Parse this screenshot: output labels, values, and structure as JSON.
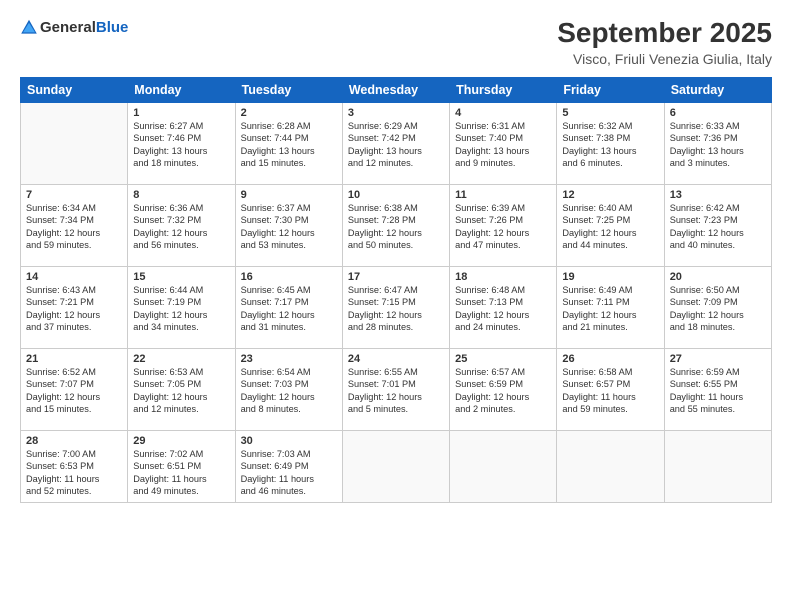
{
  "header": {
    "logo_general": "General",
    "logo_blue": "Blue",
    "month": "September 2025",
    "location": "Visco, Friuli Venezia Giulia, Italy"
  },
  "days_of_week": [
    "Sunday",
    "Monday",
    "Tuesday",
    "Wednesday",
    "Thursday",
    "Friday",
    "Saturday"
  ],
  "weeks": [
    [
      {
        "day": "",
        "lines": []
      },
      {
        "day": "1",
        "lines": [
          "Sunrise: 6:27 AM",
          "Sunset: 7:46 PM",
          "Daylight: 13 hours",
          "and 18 minutes."
        ]
      },
      {
        "day": "2",
        "lines": [
          "Sunrise: 6:28 AM",
          "Sunset: 7:44 PM",
          "Daylight: 13 hours",
          "and 15 minutes."
        ]
      },
      {
        "day": "3",
        "lines": [
          "Sunrise: 6:29 AM",
          "Sunset: 7:42 PM",
          "Daylight: 13 hours",
          "and 12 minutes."
        ]
      },
      {
        "day": "4",
        "lines": [
          "Sunrise: 6:31 AM",
          "Sunset: 7:40 PM",
          "Daylight: 13 hours",
          "and 9 minutes."
        ]
      },
      {
        "day": "5",
        "lines": [
          "Sunrise: 6:32 AM",
          "Sunset: 7:38 PM",
          "Daylight: 13 hours",
          "and 6 minutes."
        ]
      },
      {
        "day": "6",
        "lines": [
          "Sunrise: 6:33 AM",
          "Sunset: 7:36 PM",
          "Daylight: 13 hours",
          "and 3 minutes."
        ]
      }
    ],
    [
      {
        "day": "7",
        "lines": [
          "Sunrise: 6:34 AM",
          "Sunset: 7:34 PM",
          "Daylight: 12 hours",
          "and 59 minutes."
        ]
      },
      {
        "day": "8",
        "lines": [
          "Sunrise: 6:36 AM",
          "Sunset: 7:32 PM",
          "Daylight: 12 hours",
          "and 56 minutes."
        ]
      },
      {
        "day": "9",
        "lines": [
          "Sunrise: 6:37 AM",
          "Sunset: 7:30 PM",
          "Daylight: 12 hours",
          "and 53 minutes."
        ]
      },
      {
        "day": "10",
        "lines": [
          "Sunrise: 6:38 AM",
          "Sunset: 7:28 PM",
          "Daylight: 12 hours",
          "and 50 minutes."
        ]
      },
      {
        "day": "11",
        "lines": [
          "Sunrise: 6:39 AM",
          "Sunset: 7:26 PM",
          "Daylight: 12 hours",
          "and 47 minutes."
        ]
      },
      {
        "day": "12",
        "lines": [
          "Sunrise: 6:40 AM",
          "Sunset: 7:25 PM",
          "Daylight: 12 hours",
          "and 44 minutes."
        ]
      },
      {
        "day": "13",
        "lines": [
          "Sunrise: 6:42 AM",
          "Sunset: 7:23 PM",
          "Daylight: 12 hours",
          "and 40 minutes."
        ]
      }
    ],
    [
      {
        "day": "14",
        "lines": [
          "Sunrise: 6:43 AM",
          "Sunset: 7:21 PM",
          "Daylight: 12 hours",
          "and 37 minutes."
        ]
      },
      {
        "day": "15",
        "lines": [
          "Sunrise: 6:44 AM",
          "Sunset: 7:19 PM",
          "Daylight: 12 hours",
          "and 34 minutes."
        ]
      },
      {
        "day": "16",
        "lines": [
          "Sunrise: 6:45 AM",
          "Sunset: 7:17 PM",
          "Daylight: 12 hours",
          "and 31 minutes."
        ]
      },
      {
        "day": "17",
        "lines": [
          "Sunrise: 6:47 AM",
          "Sunset: 7:15 PM",
          "Daylight: 12 hours",
          "and 28 minutes."
        ]
      },
      {
        "day": "18",
        "lines": [
          "Sunrise: 6:48 AM",
          "Sunset: 7:13 PM",
          "Daylight: 12 hours",
          "and 24 minutes."
        ]
      },
      {
        "day": "19",
        "lines": [
          "Sunrise: 6:49 AM",
          "Sunset: 7:11 PM",
          "Daylight: 12 hours",
          "and 21 minutes."
        ]
      },
      {
        "day": "20",
        "lines": [
          "Sunrise: 6:50 AM",
          "Sunset: 7:09 PM",
          "Daylight: 12 hours",
          "and 18 minutes."
        ]
      }
    ],
    [
      {
        "day": "21",
        "lines": [
          "Sunrise: 6:52 AM",
          "Sunset: 7:07 PM",
          "Daylight: 12 hours",
          "and 15 minutes."
        ]
      },
      {
        "day": "22",
        "lines": [
          "Sunrise: 6:53 AM",
          "Sunset: 7:05 PM",
          "Daylight: 12 hours",
          "and 12 minutes."
        ]
      },
      {
        "day": "23",
        "lines": [
          "Sunrise: 6:54 AM",
          "Sunset: 7:03 PM",
          "Daylight: 12 hours",
          "and 8 minutes."
        ]
      },
      {
        "day": "24",
        "lines": [
          "Sunrise: 6:55 AM",
          "Sunset: 7:01 PM",
          "Daylight: 12 hours",
          "and 5 minutes."
        ]
      },
      {
        "day": "25",
        "lines": [
          "Sunrise: 6:57 AM",
          "Sunset: 6:59 PM",
          "Daylight: 12 hours",
          "and 2 minutes."
        ]
      },
      {
        "day": "26",
        "lines": [
          "Sunrise: 6:58 AM",
          "Sunset: 6:57 PM",
          "Daylight: 11 hours",
          "and 59 minutes."
        ]
      },
      {
        "day": "27",
        "lines": [
          "Sunrise: 6:59 AM",
          "Sunset: 6:55 PM",
          "Daylight: 11 hours",
          "and 55 minutes."
        ]
      }
    ],
    [
      {
        "day": "28",
        "lines": [
          "Sunrise: 7:00 AM",
          "Sunset: 6:53 PM",
          "Daylight: 11 hours",
          "and 52 minutes."
        ]
      },
      {
        "day": "29",
        "lines": [
          "Sunrise: 7:02 AM",
          "Sunset: 6:51 PM",
          "Daylight: 11 hours",
          "and 49 minutes."
        ]
      },
      {
        "day": "30",
        "lines": [
          "Sunrise: 7:03 AM",
          "Sunset: 6:49 PM",
          "Daylight: 11 hours",
          "and 46 minutes."
        ]
      },
      {
        "day": "",
        "lines": []
      },
      {
        "day": "",
        "lines": []
      },
      {
        "day": "",
        "lines": []
      },
      {
        "day": "",
        "lines": []
      }
    ]
  ]
}
